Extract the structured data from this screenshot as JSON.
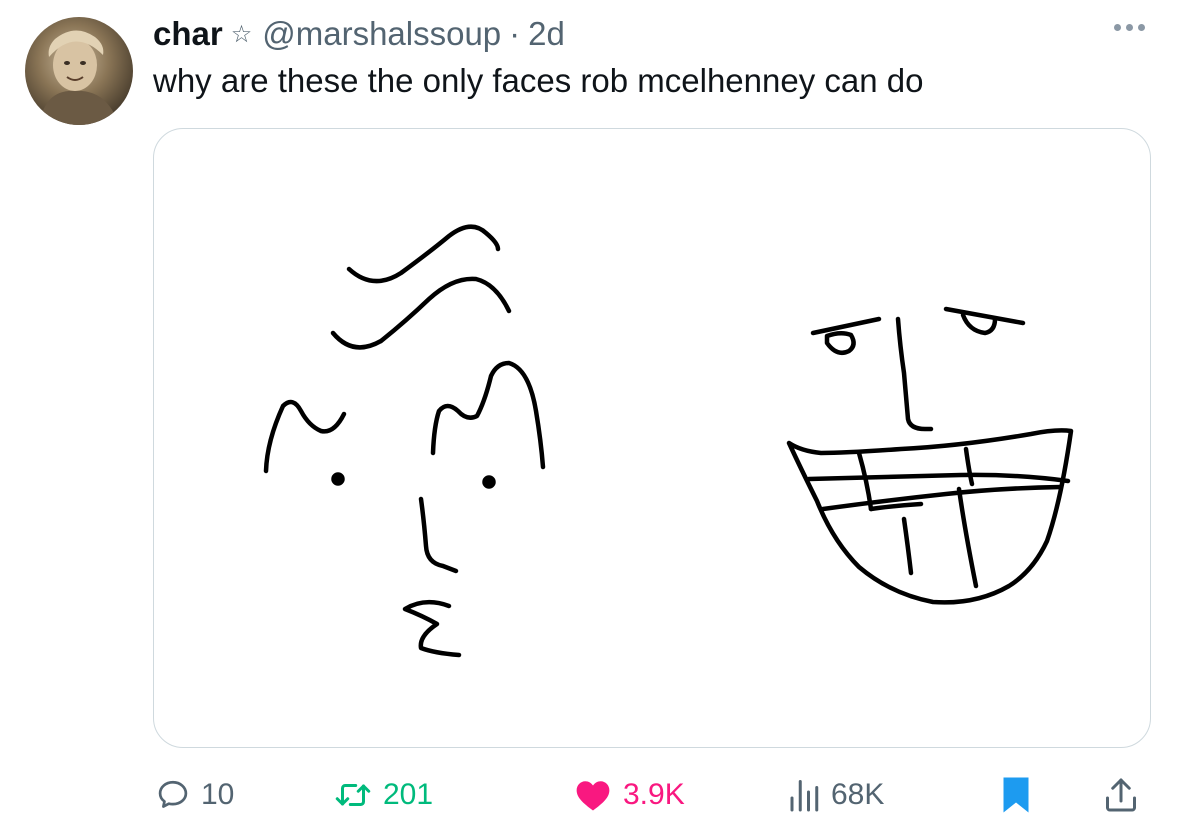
{
  "author": {
    "display_name": "char",
    "star_glyph": "☆",
    "handle": "@marshalssoup",
    "separator": "·",
    "time": "2d"
  },
  "tweet": {
    "text": "why are these the only faces rob mcelhenney can do"
  },
  "actions": {
    "reply_count": "10",
    "retweet_count": "201",
    "like_count": "3.9K",
    "view_count": "68K"
  },
  "colors": {
    "text": "#0f1419",
    "muted": "#536471",
    "retweet": "#00ba7c",
    "like": "#f91880",
    "bookmark": "#1d9bf0"
  },
  "icons": {
    "more": "more-horizontal-icon",
    "reply": "speech-bubble-icon",
    "retweet": "retweet-arrows-icon",
    "like": "heart-filled-icon",
    "views": "bar-chart-icon",
    "bookmark": "bookmark-filled-icon",
    "share": "share-upload-icon"
  }
}
